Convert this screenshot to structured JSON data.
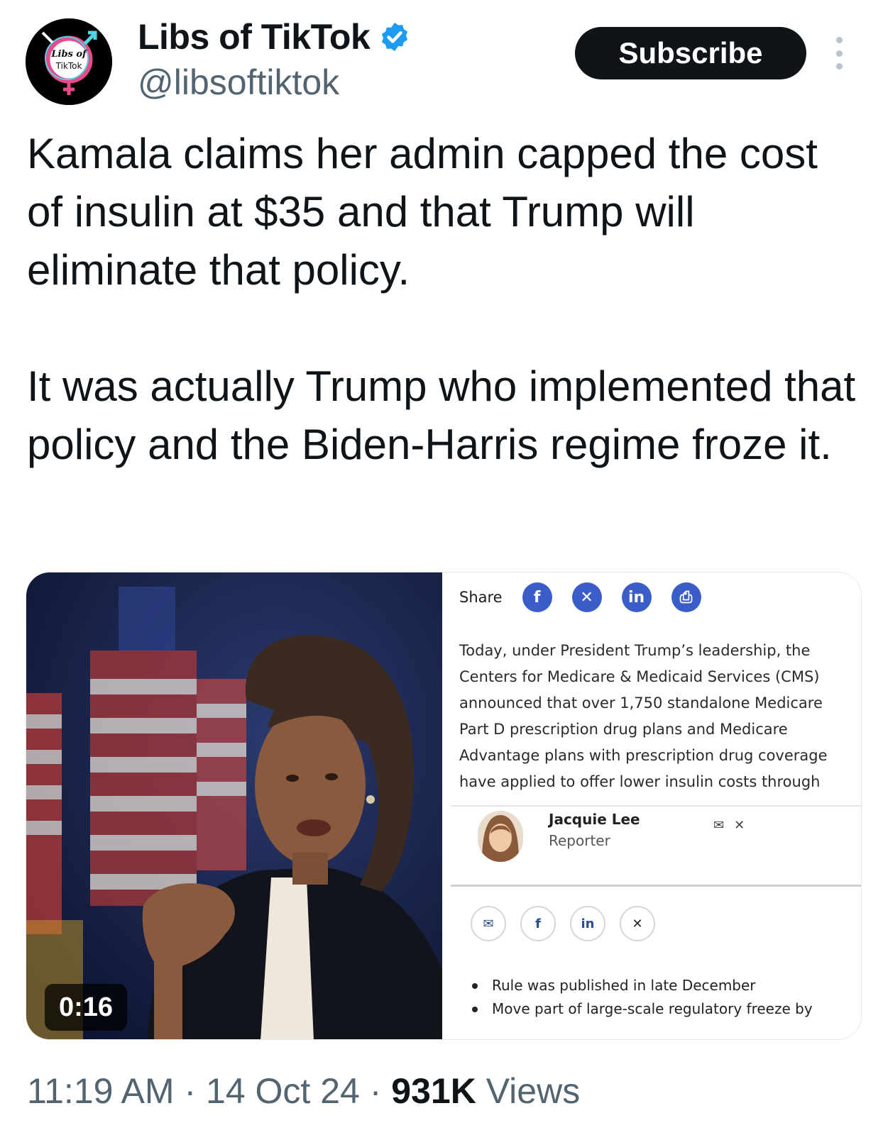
{
  "author": {
    "display_name": "Libs of TikTok",
    "handle": "@libsoftiktok",
    "verified": true,
    "avatar_text_line1": "Libs of",
    "avatar_text_line2": "TikTok"
  },
  "actions": {
    "subscribe_label": "Subscribe",
    "more_icon": "more-vertical-icon"
  },
  "tweet": {
    "paragraph1": "Kamala claims her admin capped the cost of insulin at $35 and that Trump will eliminate that policy.",
    "paragraph2": "It was actually Trump who implemented that policy and the Biden-Harris regime froze it."
  },
  "media": {
    "video_duration": "0:16",
    "article": {
      "share_label": "Share",
      "share_icons": [
        "facebook-icon",
        "x-icon",
        "linkedin-icon",
        "print-icon"
      ],
      "body": "Today, under President Trump’s leadership, the Centers for Medicare & Medicaid Services (CMS) announced that over 1,750 standalone Medicare Part D prescription drug plans and Medicare Advantage plans with prescription drug coverage have applied to offer lower insulin costs through the Part D Senior Savings",
      "reporter_name": "Jacquie Lee",
      "reporter_role": "Reporter",
      "social_icons": [
        "mail-icon",
        "facebook-icon",
        "linkedin-icon",
        "x-icon"
      ],
      "bullets": [
        "Rule was published in late December",
        "Move part of large-scale regulatory freeze by"
      ]
    }
  },
  "meta": {
    "time": "11:19 AM",
    "separator": "·",
    "date": "14 Oct 24",
    "views_count": "931K",
    "views_label": "Views"
  },
  "colors": {
    "text": "#0f1419",
    "secondary": "#536471",
    "verified": "#1d9bf0",
    "button": "#0f1419",
    "share_icon": "#3b5dc9"
  }
}
